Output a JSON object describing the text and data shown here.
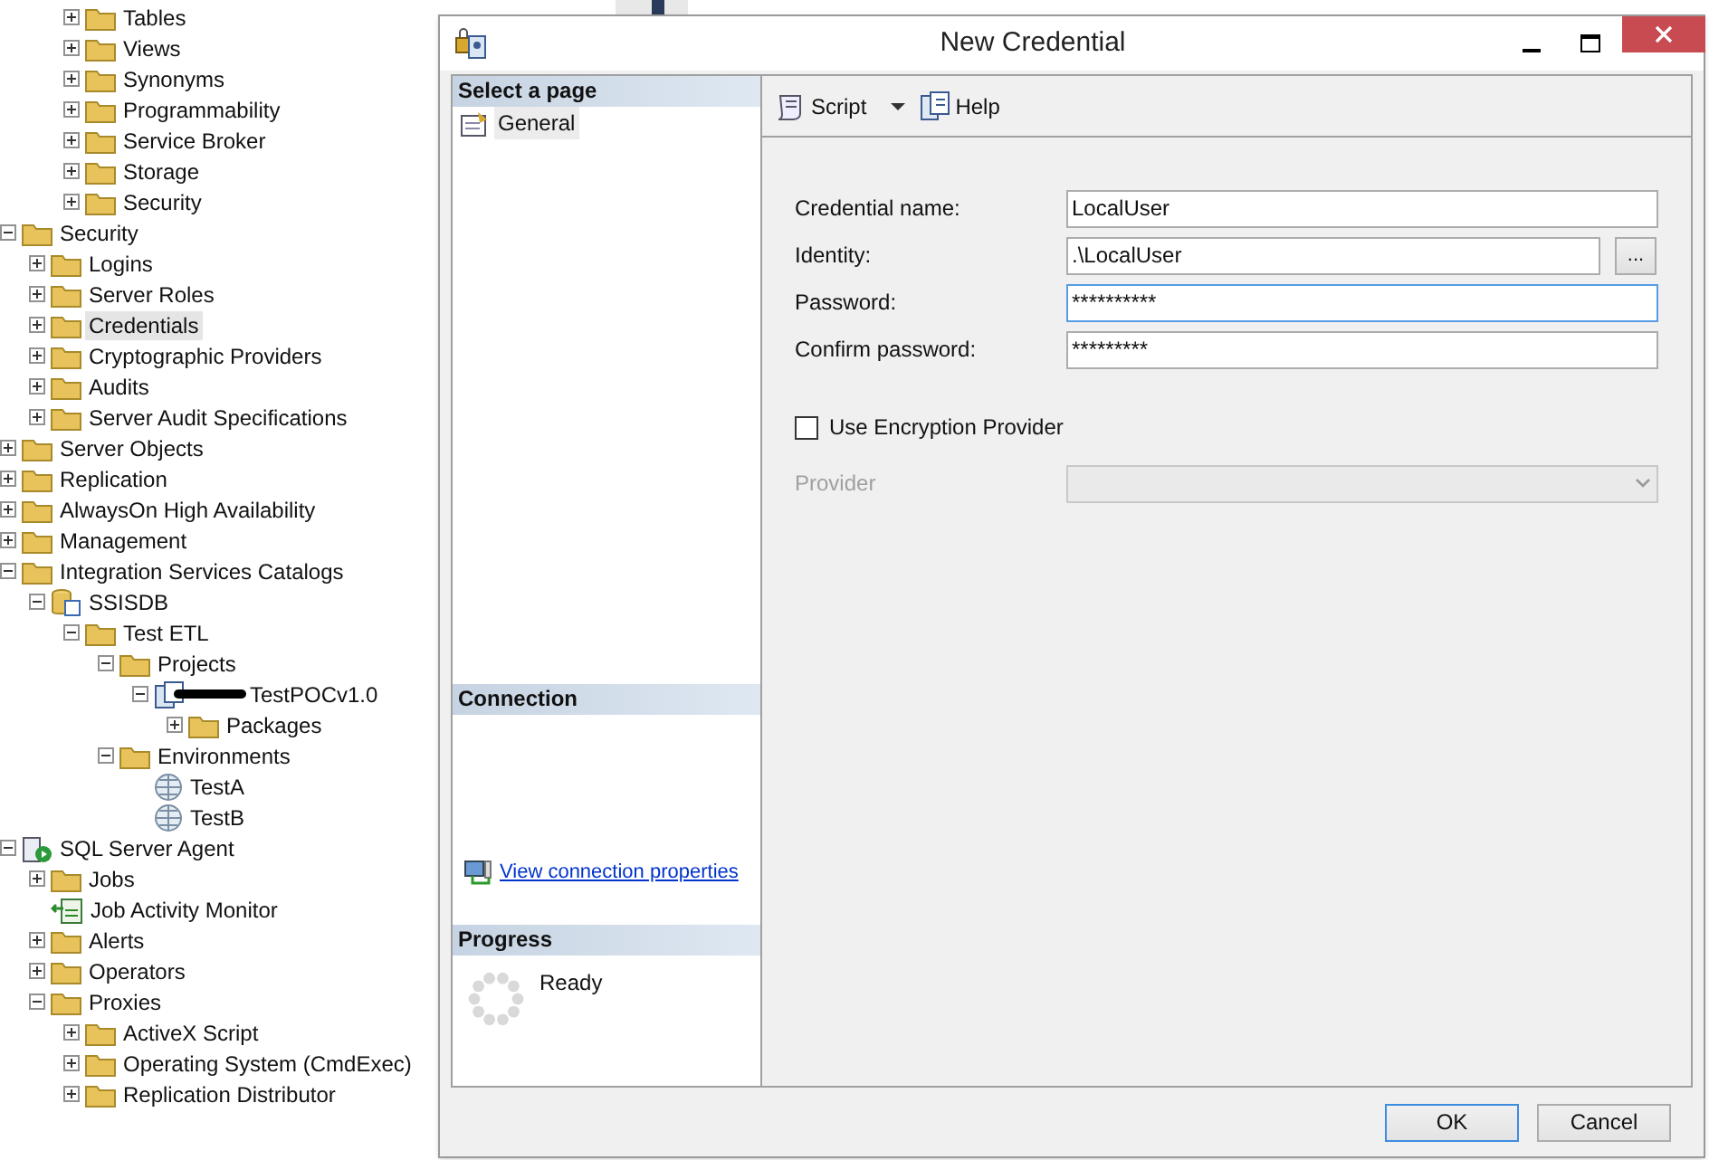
{
  "tree": {
    "scrolled_parent_children": [
      {
        "label": "Tables",
        "kind": "folder",
        "expanded": false,
        "selected": false
      },
      {
        "label": "Views",
        "kind": "folder",
        "expanded": false,
        "selected": false
      },
      {
        "label": "Synonyms",
        "kind": "folder",
        "expanded": false,
        "selected": false
      },
      {
        "label": "Programmability",
        "kind": "folder",
        "expanded": false,
        "selected": false
      },
      {
        "label": "Service Broker",
        "kind": "folder",
        "expanded": false,
        "selected": false
      },
      {
        "label": "Storage",
        "kind": "folder",
        "expanded": false,
        "selected": false
      },
      {
        "label": "Security",
        "kind": "folder",
        "expanded": false,
        "selected": false
      }
    ],
    "items": [
      {
        "label": "Security",
        "kind": "folder",
        "expanded": true,
        "selected": false,
        "children": [
          {
            "label": "Logins",
            "kind": "folder",
            "expanded": false,
            "selected": false
          },
          {
            "label": "Server Roles",
            "kind": "folder",
            "expanded": false,
            "selected": false
          },
          {
            "label": "Credentials",
            "kind": "folder",
            "expanded": false,
            "selected": true
          },
          {
            "label": "Cryptographic Providers",
            "kind": "folder",
            "expanded": false,
            "selected": false
          },
          {
            "label": "Audits",
            "kind": "folder",
            "expanded": false,
            "selected": false
          },
          {
            "label": "Server Audit Specifications",
            "kind": "folder",
            "expanded": false,
            "selected": false
          }
        ]
      },
      {
        "label": "Server Objects",
        "kind": "folder",
        "expanded": false,
        "selected": false
      },
      {
        "label": "Replication",
        "kind": "folder",
        "expanded": false,
        "selected": false
      },
      {
        "label": "AlwaysOn High Availability",
        "kind": "folder",
        "expanded": false,
        "selected": false
      },
      {
        "label": "Management",
        "kind": "folder",
        "expanded": false,
        "selected": false
      },
      {
        "label": "Integration Services Catalogs",
        "kind": "folder",
        "expanded": true,
        "selected": false,
        "children": [
          {
            "label": "SSISDB",
            "kind": "database",
            "expanded": true,
            "selected": false,
            "children": [
              {
                "label": "Test ETL",
                "kind": "folder",
                "expanded": true,
                "selected": false,
                "children": [
                  {
                    "label": "Projects",
                    "kind": "folder",
                    "expanded": true,
                    "selected": false,
                    "children": [
                      {
                        "label": "TestPOCv1.0",
                        "kind": "project",
                        "redacted": true,
                        "expanded": true,
                        "selected": false,
                        "children": [
                          {
                            "label": "Packages",
                            "kind": "folder",
                            "expanded": false,
                            "selected": false
                          }
                        ]
                      }
                    ]
                  },
                  {
                    "label": "Environments",
                    "kind": "folder",
                    "expanded": true,
                    "selected": false,
                    "children": [
                      {
                        "label": "TestA",
                        "kind": "environment",
                        "selected": false
                      },
                      {
                        "label": "TestB",
                        "kind": "environment",
                        "selected": false
                      }
                    ]
                  }
                ]
              }
            ]
          }
        ]
      },
      {
        "label": "SQL Server Agent",
        "kind": "agent",
        "expanded": true,
        "selected": false,
        "children": [
          {
            "label": "Jobs",
            "kind": "folder",
            "expanded": false,
            "selected": false
          },
          {
            "label": "Job Activity Monitor",
            "kind": "monitor",
            "selected": false
          },
          {
            "label": "Alerts",
            "kind": "folder",
            "expanded": false,
            "selected": false
          },
          {
            "label": "Operators",
            "kind": "folder",
            "expanded": false,
            "selected": false
          },
          {
            "label": "Proxies",
            "kind": "folder",
            "expanded": true,
            "selected": false,
            "children": [
              {
                "label": "ActiveX Script",
                "kind": "folder",
                "expanded": false,
                "selected": false
              },
              {
                "label": "Operating System (CmdExec)",
                "kind": "folder",
                "expanded": false,
                "selected": false
              },
              {
                "label": "Replication Distributor",
                "kind": "folder",
                "expanded": false,
                "selected": false
              }
            ]
          }
        ]
      }
    ]
  },
  "dialog": {
    "title": "New Credential",
    "select_page": {
      "header": "Select a page",
      "pages": [
        {
          "label": "General",
          "selected": true
        }
      ]
    },
    "connection": {
      "header": "Connection",
      "link": "View connection properties"
    },
    "progress": {
      "header": "Progress",
      "status": "Ready"
    },
    "toolbar": [
      {
        "label": "Script",
        "kind": "script"
      },
      {
        "label": "Help",
        "kind": "help"
      }
    ],
    "fields": [
      {
        "label": "Credential name:",
        "value": "LocalUser",
        "focused": false
      },
      {
        "label": "Identity:",
        "value": ".\\LocalUser",
        "focused": false,
        "browse": "..."
      },
      {
        "label": "Password:",
        "value": "**********",
        "focused": true
      },
      {
        "label": "Confirm password:",
        "value": "*********",
        "focused": false
      }
    ],
    "encryption": {
      "label": "Use Encryption Provider",
      "checked": false
    },
    "provider": {
      "label": "Provider",
      "disabled": true
    },
    "buttons": [
      {
        "label": "OK",
        "default": true
      },
      {
        "label": "Cancel",
        "default": false
      }
    ]
  }
}
